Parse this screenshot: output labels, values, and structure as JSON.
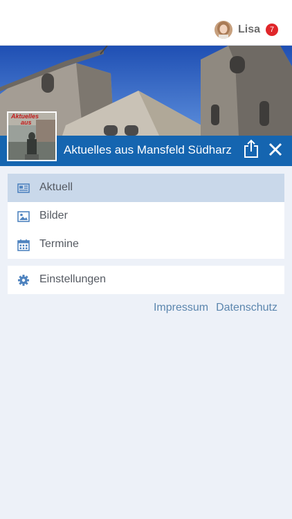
{
  "user": {
    "name": "Lisa",
    "notification_count": "7"
  },
  "header": {
    "title": "Aktuelles aus Mansfeld Südharz",
    "thumbnail_text": "Aktuelles aus",
    "share_icon": "share-icon",
    "close_icon": "close-icon"
  },
  "menu": {
    "primary": [
      {
        "label": "Aktuell",
        "icon": "newspaper-icon",
        "active": true
      },
      {
        "label": "Bilder",
        "icon": "image-icon",
        "active": false
      },
      {
        "label": "Termine",
        "icon": "calendar-icon",
        "active": false
      }
    ],
    "secondary": [
      {
        "label": "Einstellungen",
        "icon": "gear-icon",
        "active": false
      }
    ]
  },
  "footer": {
    "impressum": "Impressum",
    "datenschutz": "Datenschutz"
  },
  "colors": {
    "accent": "#1565b0",
    "icon": "#4f83bf",
    "background": "#edf1f8",
    "active_item": "#c9d8ea",
    "badge": "#e0262a",
    "link": "#5b86ae"
  }
}
